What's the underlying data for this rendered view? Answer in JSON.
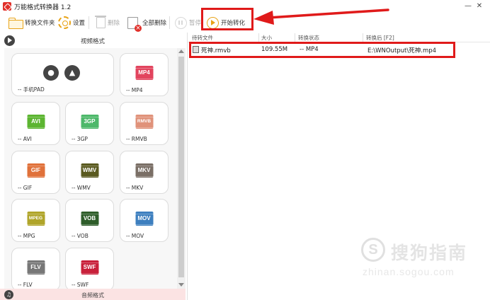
{
  "window": {
    "title": "万能格式转换器 1.2",
    "minimize_glyph": "—",
    "close_glyph": "✕"
  },
  "toolbar": {
    "convert_folder_label": "转换文件夹",
    "settings_label": "设置",
    "delete_label": "删除",
    "delete_all_label": "全部删除",
    "pause_label": "暂停",
    "start_label": "开始转化"
  },
  "left_panel": {
    "video_header": "视频格式",
    "audio_header": "音频格式",
    "device_tile_label": "-- 手机PAD",
    "formats": [
      {
        "badge": "MP4",
        "label": "-- MP4",
        "color": "#e2445e"
      },
      {
        "badge": "AVI",
        "label": "-- AVI",
        "color": "#5cb531"
      },
      {
        "badge": "3GP",
        "label": "-- 3GP",
        "color": "#4db86a"
      },
      {
        "badge": "RMVB",
        "label": "-- RMVB",
        "color": "#e0927a"
      },
      {
        "badge": "GIF",
        "label": "-- GIF",
        "color": "#e0713a"
      },
      {
        "badge": "WMV",
        "label": "-- WMV",
        "color": "#5a5a20"
      },
      {
        "badge": "MKV",
        "label": "-- MKV",
        "color": "#7a6f66"
      },
      {
        "badge": "MPEG",
        "label": "-- MPG",
        "color": "#b0a52a"
      },
      {
        "badge": "VOB",
        "label": "-- VOB",
        "color": "#2e5d2a"
      },
      {
        "badge": "MOV",
        "label": "-- MOV",
        "color": "#3d7fbf"
      },
      {
        "badge": "FLV",
        "label": "-- FLV",
        "color": "#777777"
      },
      {
        "badge": "SWF",
        "label": "-- SWF",
        "color": "#c8203a"
      }
    ]
  },
  "table": {
    "columns": [
      "待转文件",
      "大小",
      "转换状态",
      "转换后 [F2]"
    ],
    "rows": [
      {
        "file": "死神.rmvb",
        "size": "109.55M",
        "status": "-- MP4",
        "output": "E:\\WNOutput\\死神.mp4"
      }
    ]
  },
  "watermark": {
    "logo_letter": "S",
    "text": "搜狗指南",
    "url": "zhinan.sogou.com"
  },
  "colors": {
    "accent": "#e8a317",
    "annotation_red": "#e01a1a"
  }
}
